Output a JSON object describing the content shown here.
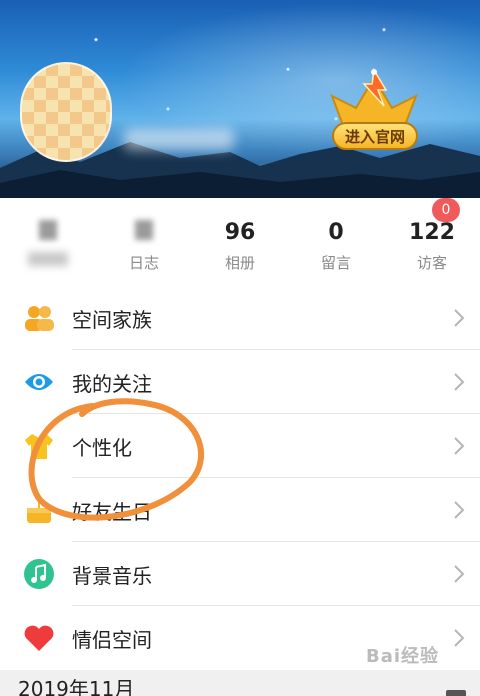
{
  "header": {
    "vip_button": "进入官网"
  },
  "stats": [
    {
      "num": "",
      "label": ""
    },
    {
      "num": "",
      "label": "日志"
    },
    {
      "num": "96",
      "label": "相册"
    },
    {
      "num": "0",
      "label": "留言"
    },
    {
      "num": "122",
      "label": "访客"
    }
  ],
  "visitor_badge": "0",
  "menu": [
    {
      "label": "空间家族",
      "icon": "people-icon"
    },
    {
      "label": "我的关注",
      "icon": "eye-icon"
    },
    {
      "label": "个性化",
      "icon": "shirt-icon"
    },
    {
      "label": "好友生日",
      "icon": "cake-icon"
    },
    {
      "label": "背景音乐",
      "icon": "music-note-icon"
    },
    {
      "label": "情侣空间",
      "icon": "heart-icon"
    }
  ],
  "footer": {
    "date_heading": "2019年11月"
  },
  "watermark": "Bai经验",
  "colors": {
    "accent_orange": "#f5a623",
    "eye_blue": "#1e9be6",
    "music_green": "#2fc38f",
    "heart_red": "#ee3b3b",
    "annotation_orange": "#f0903a",
    "badge_red": "#f05a5a"
  }
}
